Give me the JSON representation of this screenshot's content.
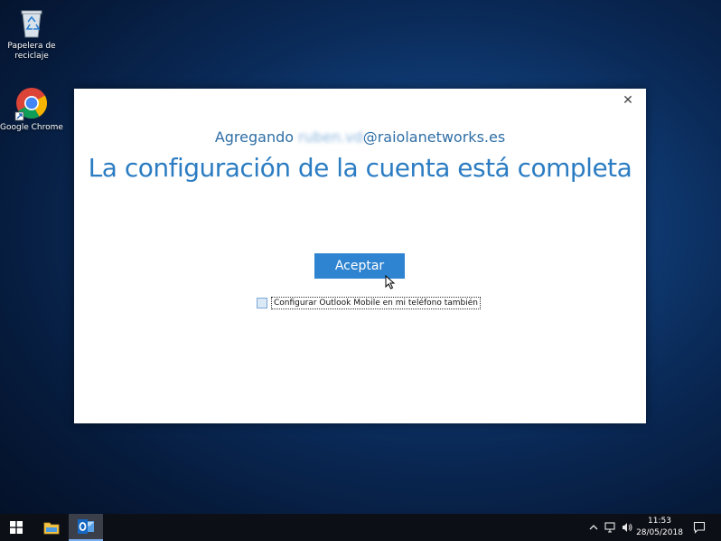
{
  "desktop": {
    "icons": [
      {
        "label": "Papelera de reciclaje",
        "icon": "recycle-bin-icon"
      },
      {
        "label": "Google Chrome",
        "icon": "chrome-icon"
      }
    ]
  },
  "dialog": {
    "subtitle_prefix": "Agregando ",
    "subtitle_blurred": "ruben.vd",
    "subtitle_suffix": "@raiolanetworks.es",
    "title": "La configuración de la cuenta está completa",
    "accept_label": "Aceptar",
    "checkbox_label": "Configurar Outlook Mobile en mi teléfono también",
    "checkbox_checked": false,
    "close_glyph": "✕"
  },
  "taskbar": {
    "apps": [
      "start-icon",
      "file-explorer-icon",
      "outlook-icon"
    ],
    "tray": [
      "chevron-up-icon",
      "network-icon",
      "volume-icon"
    ],
    "clock_time": "11:53",
    "clock_date": "28/05/2018",
    "notification_icon": "action-center-icon"
  },
  "colors": {
    "accent": "#2e84d0",
    "title": "#2b7cc2"
  }
}
